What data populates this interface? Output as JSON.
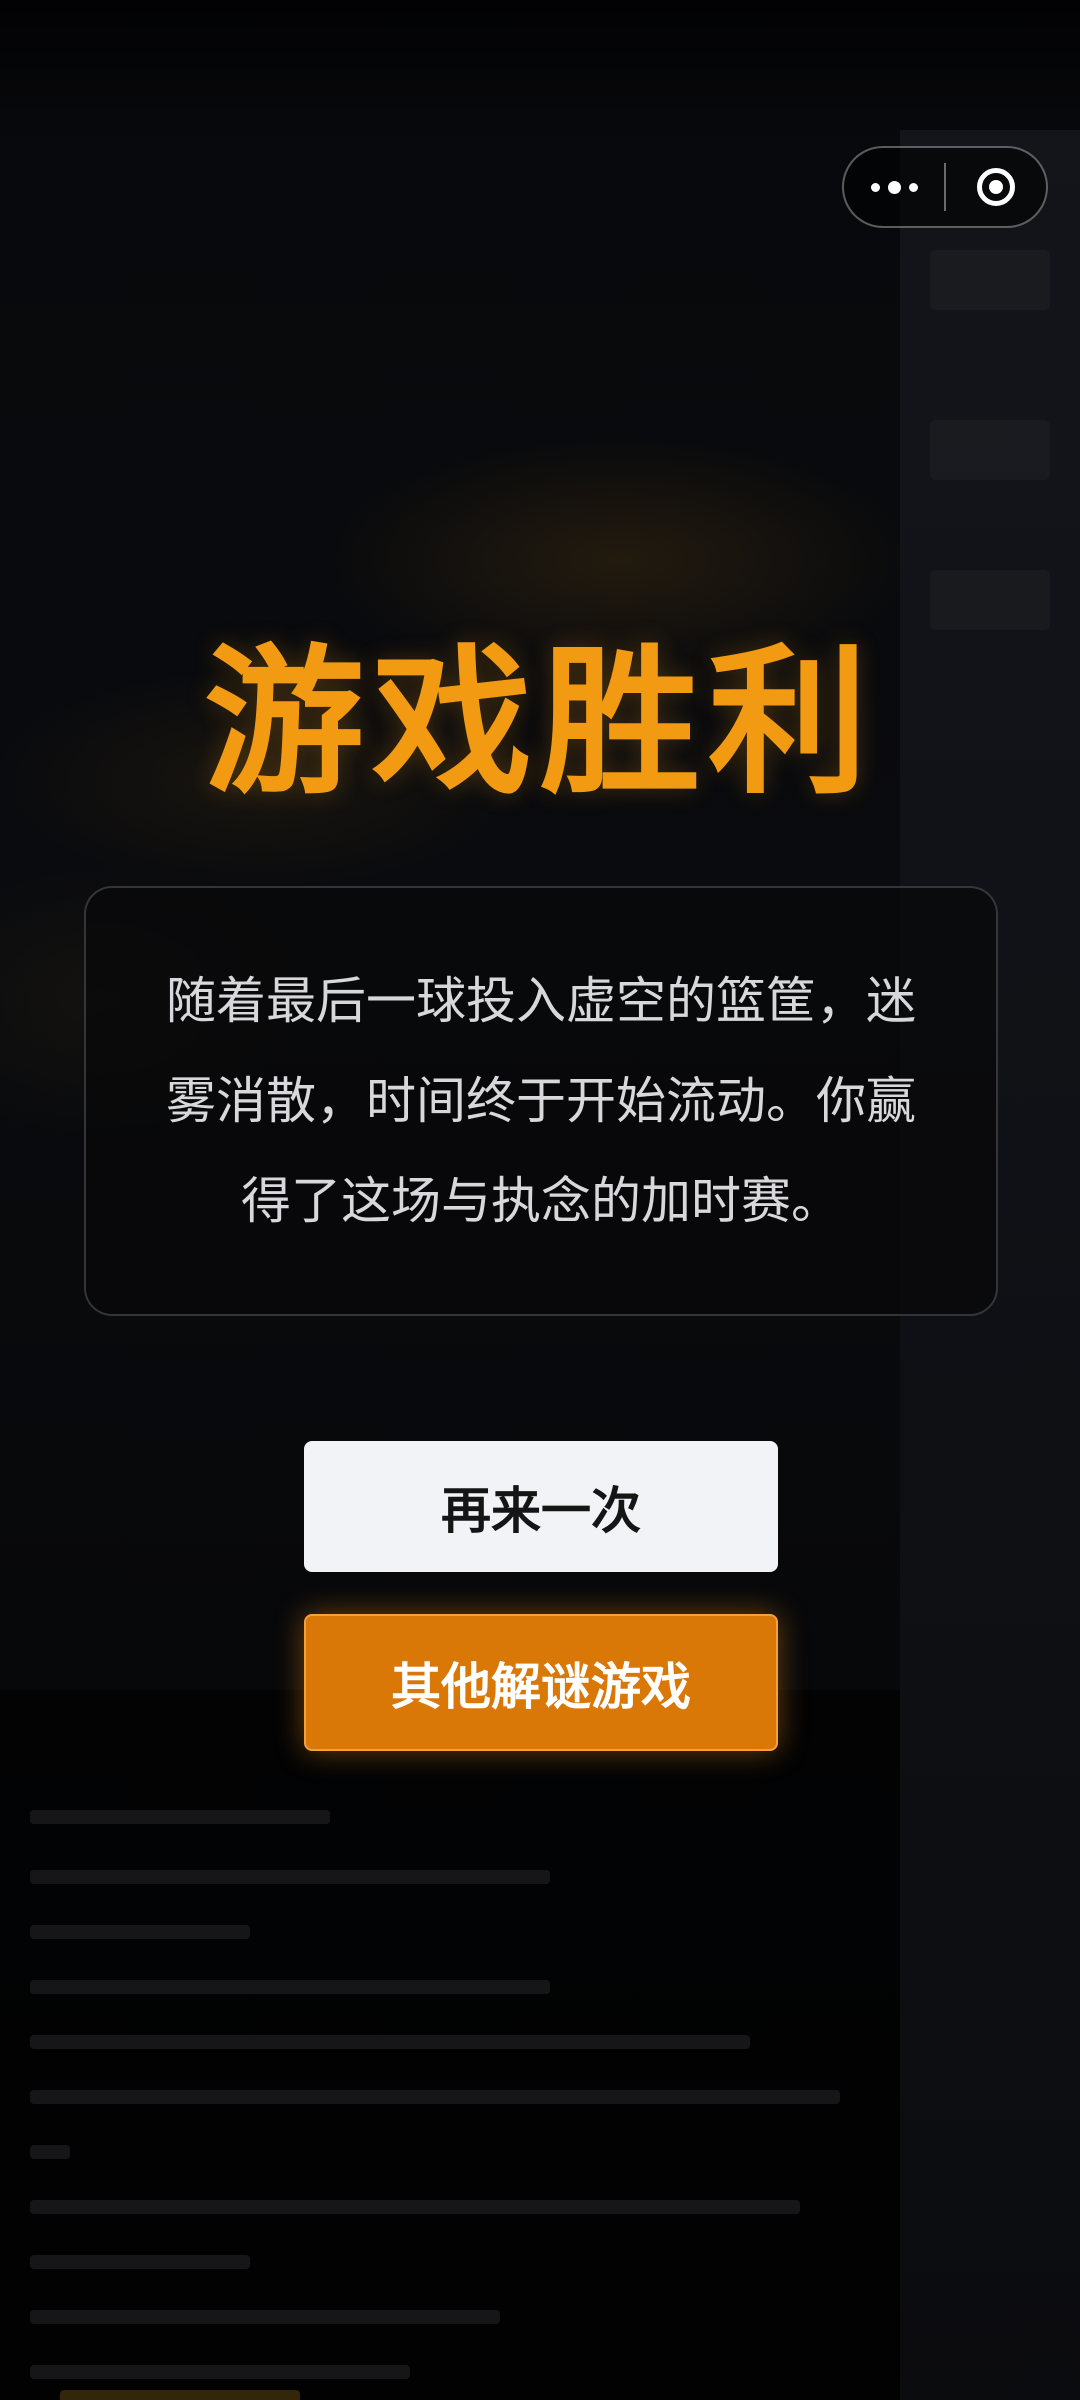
{
  "capsule": {
    "more_icon": "more-dots-icon",
    "close_icon": "close-target-icon"
  },
  "result": {
    "title": "游戏胜利",
    "story": "随着最后一球投入虚空的篮筐，迷雾消散，时间终于开始流动。你赢得了这场与执念的加时赛。"
  },
  "actions": {
    "retry_label": "再来一次",
    "other_label": "其他解谜游戏"
  },
  "colors": {
    "title": "#f29a12",
    "primary_button": "#d97707",
    "secondary_button": "#f1f3f7",
    "background": "#030304"
  }
}
